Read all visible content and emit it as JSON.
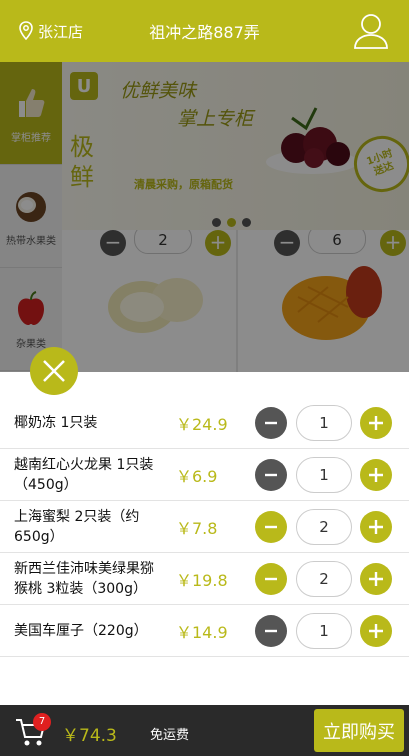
{
  "header": {
    "store": "张江店",
    "address": "祖冲之路887弄"
  },
  "sidebar": {
    "items": [
      {
        "label": "掌柜推荐",
        "active": true
      },
      {
        "label": "热带水果类",
        "active": false
      },
      {
        "label": "杂果类",
        "active": false
      }
    ]
  },
  "banner": {
    "slogan_line1": "优鲜美味",
    "slogan_line2": "掌上专柜",
    "brand": "极鲜",
    "subtitle": "清晨采购，原箱配货",
    "badge_line1": "1小时",
    "badge_line2": "送达"
  },
  "background_products": [
    {
      "qty": "2"
    },
    {
      "qty": "6"
    }
  ],
  "cart_items": [
    {
      "name": "椰奶冻 1只装",
      "price": "￥24.9",
      "qty": "1",
      "minus_active": false
    },
    {
      "name": "越南红心火龙果 1只装（450g）",
      "price": "￥6.9",
      "qty": "1",
      "minus_active": false
    },
    {
      "name": "上海蜜梨 2只装（约650g）",
      "price": "￥7.8",
      "qty": "2",
      "minus_active": true
    },
    {
      "name": "新西兰佳沛味美绿果猕猴桃 3粒装（300g）",
      "price": "￥19.8",
      "qty": "2",
      "minus_active": true
    },
    {
      "name": "美国车厘子（220g）",
      "price": "￥14.9",
      "qty": "1",
      "minus_active": false
    }
  ],
  "footer": {
    "cart_count": "7",
    "total": "￥74.3",
    "shipping": "免运费",
    "buy_label": "立即购买"
  },
  "colors": {
    "accent": "#b9b91a",
    "dark": "#2a2a2a",
    "badge": "#e02020"
  }
}
